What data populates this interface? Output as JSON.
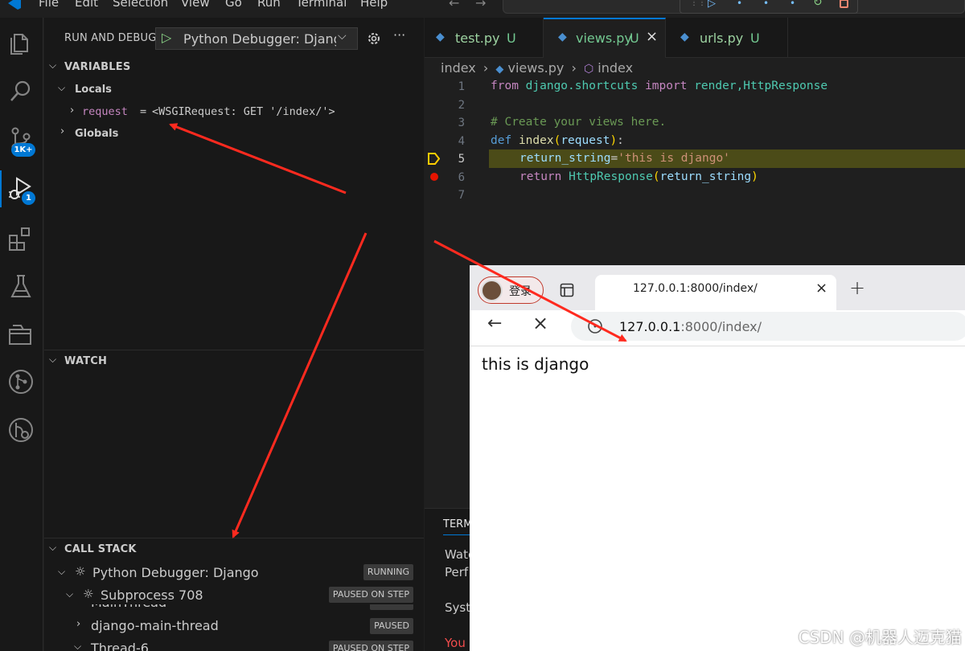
{
  "menu": {
    "file": "File",
    "edit": "Edit",
    "selection": "Selection",
    "view": "View",
    "go": "Go",
    "run": "Run",
    "terminal": "Terminal",
    "help": "Help"
  },
  "activity_bar": {
    "icons": [
      "explorer-icon",
      "search-icon",
      "source-control-icon",
      "run-debug-icon",
      "extensions-icon",
      "testing-icon",
      "remote-explorer-icon",
      "git-graph-icon",
      "timeline-icon"
    ],
    "source_control_badge": "1K+",
    "debug_badge": "1"
  },
  "sidebar": {
    "header": "RUN AND DEBUG",
    "config": "Python Debugger: Django",
    "variables": {
      "title": "VARIABLES",
      "locals": "Locals",
      "request_name": "request",
      "request_eq": "=",
      "request_value": "<WSGIRequest: GET '/index/'>",
      "globals": "Globals"
    },
    "watch_title": "WATCH",
    "call_stack": {
      "title": "CALL STACK",
      "items": [
        {
          "label": "Python Debugger: Django",
          "status": "RUNNING"
        },
        {
          "label": "Subprocess 708",
          "status": "PAUSED ON STEP"
        },
        {
          "label": "MainThread",
          "status": "PAUSED"
        },
        {
          "label": "django-main-thread",
          "status": "PAUSED"
        },
        {
          "label": "Thread-6",
          "status": "PAUSED ON STEP"
        }
      ]
    }
  },
  "tabs": [
    {
      "label": "test.py",
      "badge": "U"
    },
    {
      "label": "views.py",
      "badge": "U"
    },
    {
      "label": "urls.py",
      "badge": "U"
    }
  ],
  "breadcrumb": {
    "folder": "index",
    "file": "views.py",
    "symbol": "index"
  },
  "code_lines": [
    "1",
    "2",
    "3",
    "4",
    "5",
    "6",
    "7"
  ],
  "code": {
    "l1_from": "from",
    "l1_mod": "django.shortcuts",
    "l1_import": "import",
    "l1_names": "render,HttpResponse",
    "l3_comment": "# Create your views here.",
    "l4_def": "def",
    "l4_name": "index",
    "l4_param": "request",
    "l5_var": "return_string",
    "l5_str": "'this is django'",
    "l6_return": "return",
    "l6_cls": "HttpResponse",
    "l6_arg": "return_string"
  },
  "terminal": {
    "tab": "TERM",
    "line1": "Watc",
    "line2": "Perf",
    "line3": "Syst",
    "line4": "You"
  },
  "browser": {
    "login": "登录",
    "tab_title": "127.0.0.1:8000/index/",
    "new_tab": "+",
    "url_host": "127.0.0.1",
    "url_rest": ":8000/index/",
    "content": "this is django"
  },
  "watermark": "CSDN @机器人迈克猫",
  "colors": {
    "accent": "#0078d4",
    "arrow": "#ff2a1f",
    "keyword": "#c586c0",
    "def": "#569cd6",
    "func": "#dcdcaa",
    "string": "#ce9178",
    "var": "#9cdcfe",
    "cls": "#4ec9b0",
    "comment": "#6a9955"
  }
}
